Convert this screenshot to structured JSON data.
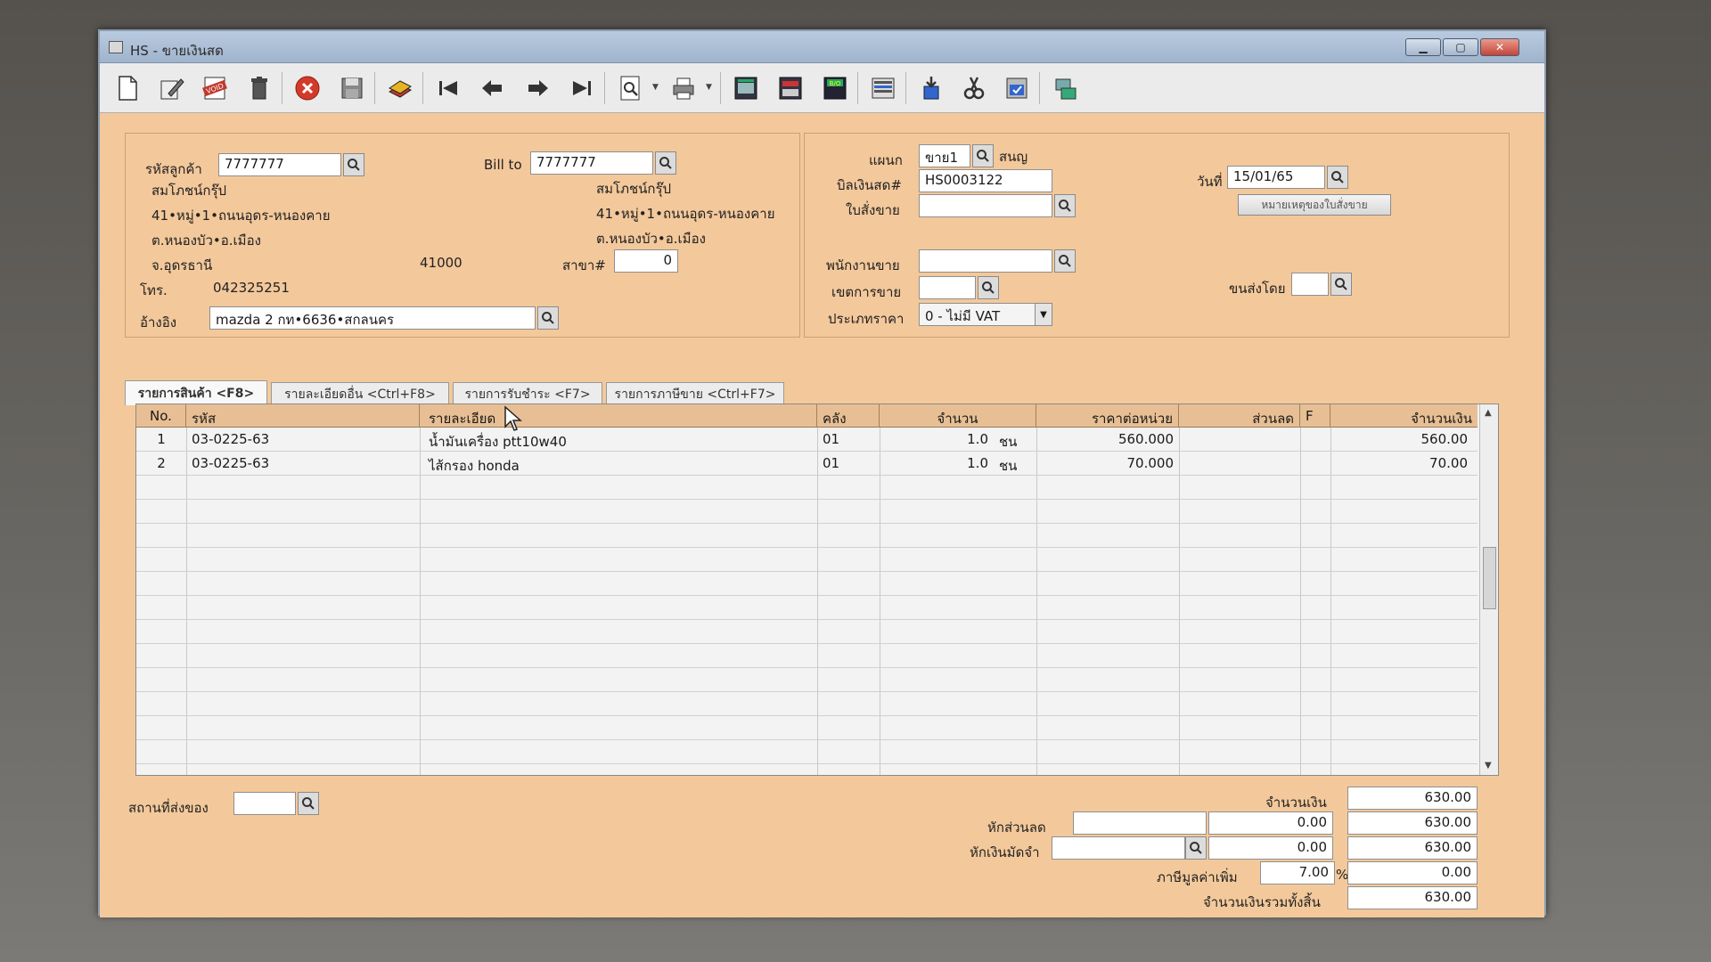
{
  "window": {
    "title": "HS - ขายเงินสด",
    "min_label": "▁",
    "max_label": "▢",
    "close_label": "✕"
  },
  "toolbar": {
    "icons": [
      "new-icon",
      "edit-icon",
      "void-icon",
      "delete-icon",
      "cancel-icon",
      "save-icon",
      "copy-icon",
      "first-icon",
      "prev-icon",
      "next-icon",
      "last-icon",
      "preview-icon",
      "print-icon",
      "export-icon",
      "import-icon",
      "bo-icon",
      "report-icon",
      "approve-icon",
      "tools-icon",
      "ok-icon",
      "network-icon"
    ],
    "void_text": "VOID",
    "bo_text": "B/O"
  },
  "customer": {
    "code_label": "รหัสลูกค้า",
    "code_value": "7777777",
    "name": "สมโภชน์กรุ๊ป",
    "address1": "41•หมู่•1•ถนนอุดร-หนองคาย",
    "address2": "ต.หนองบัว•อ.เมือง",
    "province": "จ.อุดรธานี",
    "postcode": "41000",
    "phone_label": "โทร.",
    "phone_value": "042325251",
    "ref_label": "อ้างอิง",
    "ref_value": "mazda 2 กท•6636•สกลนคร"
  },
  "billto": {
    "label": "Bill to",
    "value": "7777777",
    "name": "สมโภชน์กรุ๊ป",
    "address1": "41•หมู่•1•ถนนอุดร-หนองคาย",
    "address2": "ต.หนองบัว•อ.เมือง",
    "branch_label": "สาขา#",
    "branch_value": "0"
  },
  "doc": {
    "dept_label": "แผนก",
    "dept_value": "ขาย1",
    "dept_name": "สนญ",
    "bill_label": "บิลเงินสด#",
    "bill_value": "HS0003122",
    "so_label": "ใบสั่งขาย",
    "so_value": "",
    "date_label": "วันที่",
    "date_value": "15/01/65",
    "note_button": "หมายเหตุของใบสั่งขาย",
    "salesman_label": "พนักงานขาย",
    "salesman_value": "",
    "area_label": "เขตการขาย",
    "area_value": "",
    "ship_label": "ขนส่งโดย",
    "ship_value": "",
    "pricetype_label": "ประเภทราคา",
    "pricetype_value": "0 - ไม่มี VAT"
  },
  "tabs": [
    {
      "label": "รายการสินค้า <F8>"
    },
    {
      "label": "รายละเอียดอื่น <Ctrl+F8>"
    },
    {
      "label": "รายการรับชำระ <F7>"
    },
    {
      "label": "รายการภาษีขาย <Ctrl+F7>"
    }
  ],
  "grid": {
    "headers": [
      "No.",
      "รหัส",
      "รายละเอียด",
      "คลัง",
      "จำนวน",
      "ราคาต่อหน่วย",
      "ส่วนลด",
      "F",
      "จำนวนเงิน"
    ],
    "rows": [
      {
        "no": "1",
        "code": "03-0225-63",
        "desc": "น้ำมันเครื่อง ptt10w40",
        "wh": "01",
        "qty": "1.0",
        "unit": "ชน",
        "price": "560.000",
        "disc": "",
        "f": "",
        "amount": "560.00"
      },
      {
        "no": "2",
        "code": "03-0225-63",
        "desc": "ไส้กรอง honda",
        "wh": "01",
        "qty": "1.0",
        "unit": "ชน",
        "price": "70.000",
        "disc": "",
        "f": "",
        "amount": "70.00"
      }
    ]
  },
  "footer": {
    "delivery_label": "สถานที่ส่งของ",
    "delivery_value": "",
    "amount_label": "จำนวนเงิน",
    "amount_value": "630.00",
    "discount_label": "หักส่วนลด",
    "discount_input": "",
    "discount_value": "0.00",
    "discount_total": "630.00",
    "deposit_label": "หักเงินมัดจำ",
    "deposit_input": "",
    "deposit_value": "0.00",
    "deposit_total": "630.00",
    "vat_label": "ภาษีมูลค่าเพิ่ม",
    "vat_rate": "7.00",
    "vat_pct": "%",
    "vat_value": "0.00",
    "grand_label": "จำนวนเงินรวมทั้งสิ้น",
    "grand_value": "630.00"
  }
}
